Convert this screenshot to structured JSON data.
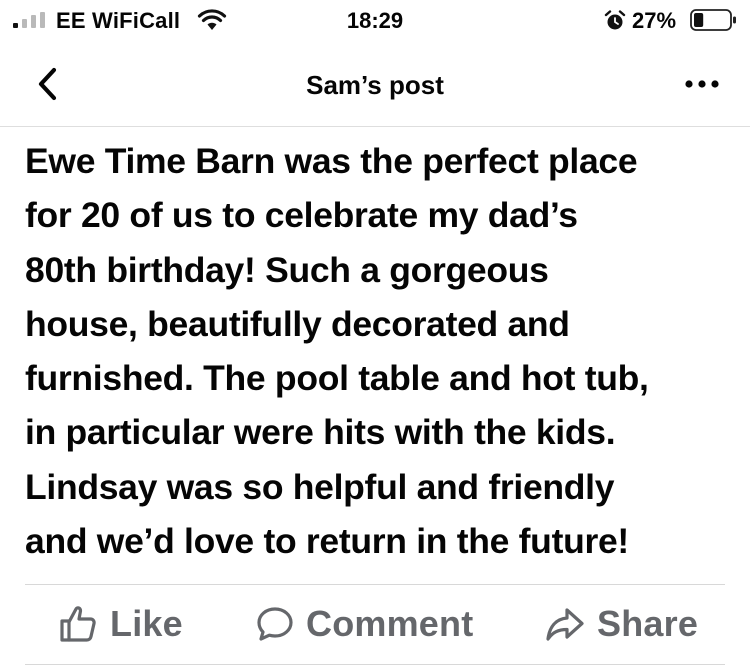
{
  "status_bar": {
    "carrier": "EE WiFiCall",
    "time": "18:29",
    "battery_percent": "27%",
    "battery_level": 0.27,
    "signal_icon": "signal-icon",
    "wifi_icon": "wifi-icon",
    "alarm_icon": "alarm-icon"
  },
  "nav": {
    "title": "Sam’s post",
    "back_icon": "chevron-left-icon",
    "more_icon": "more-dots-icon"
  },
  "post": {
    "lines": [
      "Ewe Time Barn was the perfect place",
      "for 20 of us to celebrate my dad’s",
      "80th birthday! Such a gorgeous",
      "house, beautifully decorated and",
      "furnished. The pool table and hot tub,",
      "in particular were hits with the kids.",
      "Lindsay was so helpful and friendly",
      "and we’d love to return in the future!"
    ]
  },
  "actions": {
    "like_label": "Like",
    "comment_label": "Comment",
    "share_label": "Share"
  },
  "colors": {
    "text": "#050505",
    "action_gray": "#65676b",
    "divider": "#d8d8d8",
    "background": "#ffffff"
  }
}
